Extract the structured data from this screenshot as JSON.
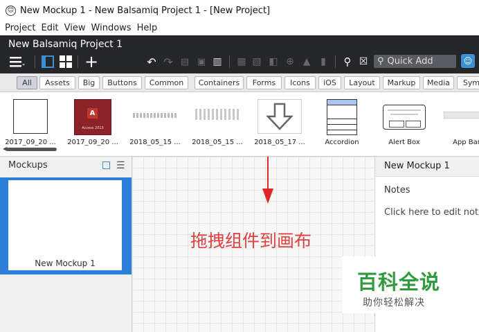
{
  "window": {
    "title": "New Mockup 1 - New Balsamiq Project 1 - [New Project]"
  },
  "menu": [
    "Project",
    "Edit",
    "View",
    "Windows",
    "Help"
  ],
  "project": {
    "name": "New Balsamiq Project 1"
  },
  "toolbar": {
    "quick_add_placeholder": "Quick Add"
  },
  "filters": {
    "active": "All",
    "items": [
      "All",
      "Assets",
      "Big",
      "Buttons",
      "Common",
      "Containers",
      "Forms",
      "Icons",
      "iOS",
      "Layout",
      "Markup",
      "Media",
      "Sym"
    ]
  },
  "library": {
    "items": [
      {
        "label": "2017_09_20 ..."
      },
      {
        "label": "2017_09_20 ...",
        "thumb_text": "Access 2013"
      },
      {
        "label": "2018_05_15 ..."
      },
      {
        "label": "2018_05_15 ..."
      },
      {
        "label": "2018_05_17 ..."
      },
      {
        "label": "Accordion"
      },
      {
        "label": "Alert Box"
      },
      {
        "label": "App Bar"
      }
    ]
  },
  "mockups_panel": {
    "title": "Mockups",
    "items": [
      {
        "label": "New Mockup 1"
      }
    ]
  },
  "canvas": {
    "hint": "拖拽组件到画布"
  },
  "properties": {
    "title": "New Mockup 1",
    "notes_label": "Notes",
    "notes_placeholder": "Click here to edit notes"
  },
  "watermark": {
    "line1": "百科全说",
    "line2": "助你轻松解决"
  },
  "colors": {
    "accent": "#2b7fd8",
    "dark_bar": "#26272a",
    "hint_red": "#e04040",
    "watermark_green": "#2f9b3e"
  }
}
